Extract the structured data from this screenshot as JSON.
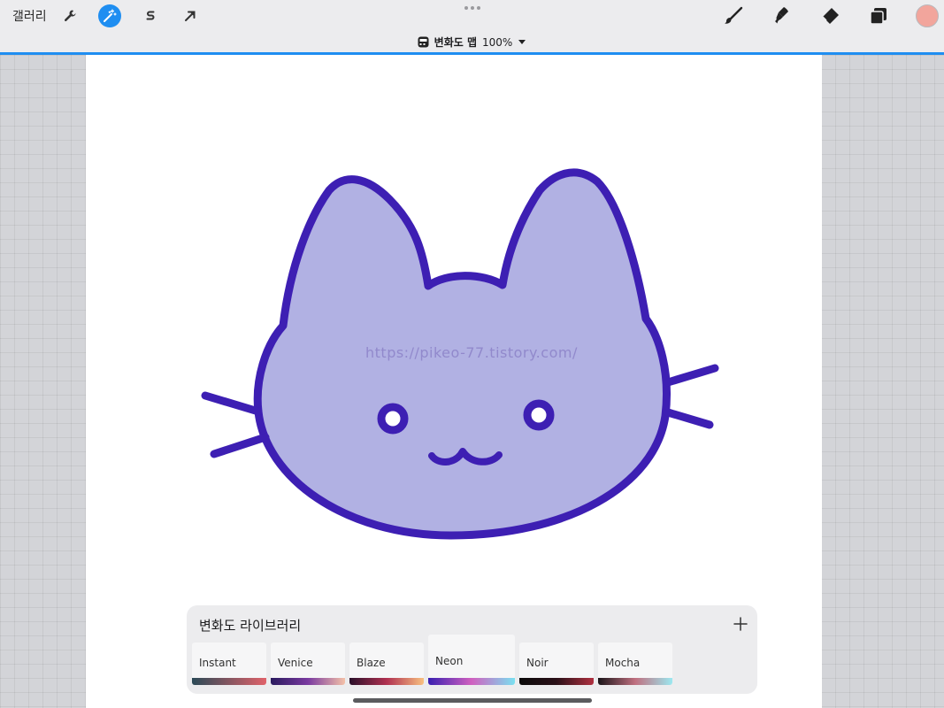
{
  "topbar": {
    "gallery_label": "갤러리",
    "left_tools": [
      {
        "name": "actions",
        "icon": "wrench-icon",
        "active": false
      },
      {
        "name": "adjustments",
        "icon": "magic-wand-icon",
        "active": true
      },
      {
        "name": "selection",
        "icon": "selection-s-icon",
        "active": false
      },
      {
        "name": "transform",
        "icon": "arrow-cursor-icon",
        "active": false
      }
    ],
    "right_tools": [
      "brush-icon",
      "smudge-icon",
      "eraser-icon",
      "layers-icon"
    ],
    "current_color": "#f2a59c",
    "accent": "#1f8ef1"
  },
  "mode_bar": {
    "mode_name": "변화도 맵",
    "percent": "100%"
  },
  "canvas": {
    "watermark": "https://pikeo-77.tistory.com/",
    "fill_color": "#b1b1e3",
    "stroke_color": "#3d1fb3"
  },
  "library": {
    "title": "변화도 라이브러리",
    "add_icon": "plus-icon",
    "presets": [
      {
        "label": "Instant",
        "gradient": [
          "#2b4a57",
          "#e0626a"
        ],
        "selected": false
      },
      {
        "label": "Venice",
        "gradient": [
          "#2a1a5e",
          "#7a3aa0",
          "#f4c1a8"
        ],
        "selected": false
      },
      {
        "label": "Blaze",
        "gradient": [
          "#2a0f2a",
          "#b03050",
          "#f8c080"
        ],
        "selected": false
      },
      {
        "label": "Neon",
        "gradient": [
          "#3a1fb0",
          "#d060c0",
          "#7ae0f0"
        ],
        "selected": true
      },
      {
        "label": "Noir",
        "gradient": [
          "#0a0a0a",
          "#2a1018",
          "#b03040"
        ],
        "selected": false
      },
      {
        "label": "Mocha",
        "gradient": [
          "#1a1418",
          "#c07080",
          "#9ce8f0"
        ],
        "selected": false
      }
    ]
  }
}
